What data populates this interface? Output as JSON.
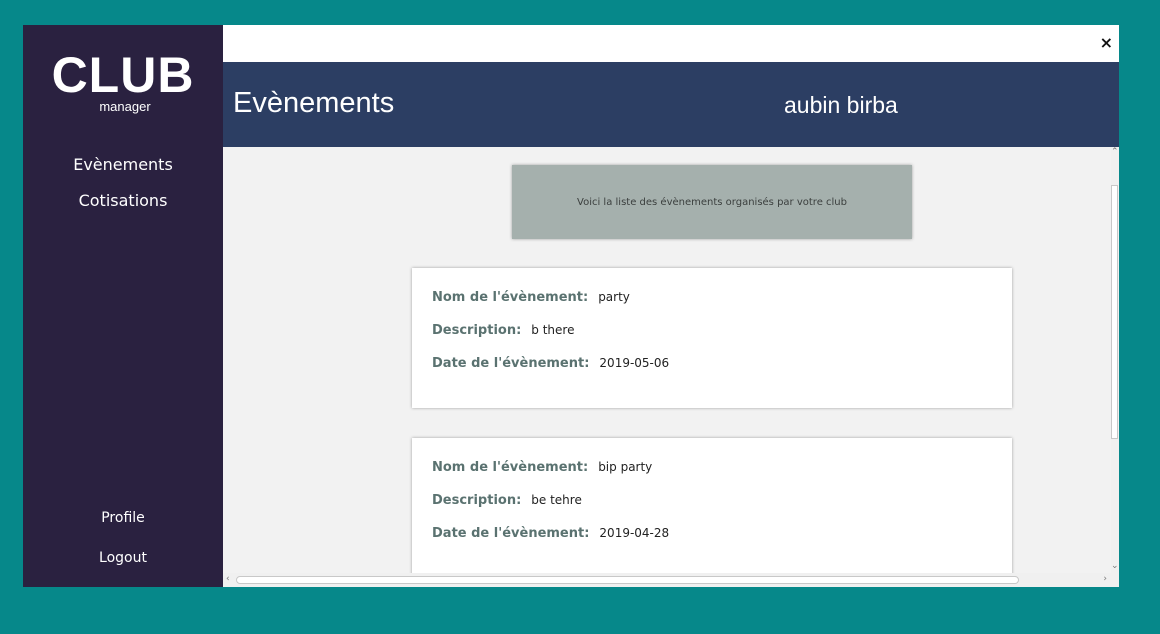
{
  "sidebar": {
    "logo_main": "CLUB",
    "logo_sub": "manager",
    "nav": [
      "Evènements",
      "Cotisations"
    ],
    "bottom": [
      "Profile",
      "Logout"
    ]
  },
  "titlebar": {
    "close": "×"
  },
  "header": {
    "title": "Evènements",
    "user": "aubin birba"
  },
  "intro": "Voici la liste des évènements organisés par votre club",
  "events": [
    {
      "name_label": "Nom de l'évènement:",
      "name": "party",
      "desc_label": "Description:",
      "desc": "b there",
      "date_label": "Date de l'évènement:",
      "date": "2019-05-06"
    },
    {
      "name_label": "Nom de l'évènement:",
      "name": "bip party",
      "desc_label": "Description:",
      "desc": "be tehre",
      "date_label": "Date de l'évènement:",
      "date": "2019-04-28"
    }
  ],
  "colors": {
    "background": "#06888a",
    "sidebar": "#2a2140",
    "header": "#2c3e63",
    "intro": "#a5b0ad",
    "label": "#5a7270"
  }
}
